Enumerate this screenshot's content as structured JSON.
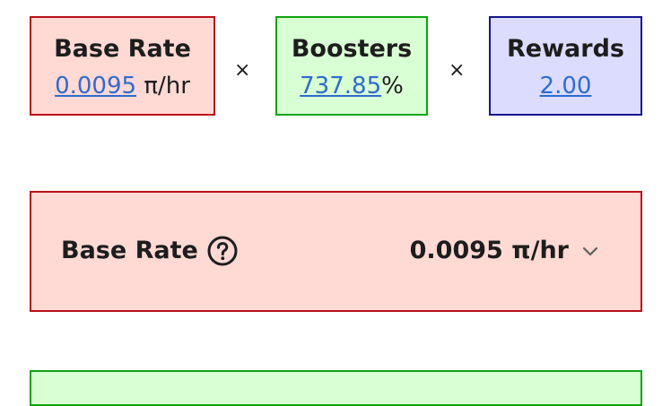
{
  "factors": {
    "base": {
      "title": "Base Rate",
      "value": "0.0095",
      "unit": " π/hr"
    },
    "boosters": {
      "title": "Boosters",
      "value": "737.85",
      "unit": "%"
    },
    "rewards": {
      "title": "Rewards",
      "value": "2.00"
    }
  },
  "operators": {
    "multiply": "×"
  },
  "rate_panel": {
    "label": "Base Rate",
    "value": "0.0095 π/hr",
    "help_icon": "question-circle-icon",
    "expand_icon": "chevron-down-icon"
  },
  "colors": {
    "base_bg": "#ffd9d4",
    "base_border": "#b8101a",
    "boost_bg": "#d9ffd4",
    "boost_border": "#11a311",
    "reward_bg": "#dcdcff",
    "reward_border": "#15158c",
    "link": "#2f6bd0"
  }
}
